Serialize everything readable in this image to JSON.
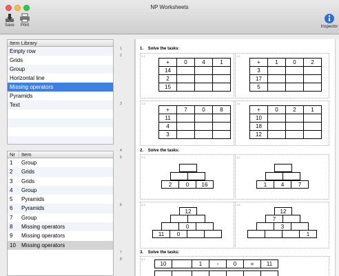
{
  "window": {
    "title": "NP Worksheets"
  },
  "toolbar": {
    "save_label": "Save",
    "print_label": "Print",
    "inspector_label": "Inspector"
  },
  "library": {
    "header": "Item Library",
    "items": [
      "Empty  row",
      "Grids",
      "Group",
      "Horizontal line",
      "Missing operators",
      "Pyramids",
      "Text"
    ],
    "selected_index": 4
  },
  "items_list": {
    "col_nr": "Nr",
    "col_item": "Item",
    "rows": [
      {
        "nr": "1",
        "item": "Group"
      },
      {
        "nr": "2",
        "item": "Grids"
      },
      {
        "nr": "3",
        "item": "Grids"
      },
      {
        "nr": "4",
        "item": "Group"
      },
      {
        "nr": "5",
        "item": "Pyramids"
      },
      {
        "nr": "6",
        "item": "Pyramids"
      },
      {
        "nr": "7",
        "item": "Group"
      },
      {
        "nr": "8",
        "item": "Missing operators"
      },
      {
        "nr": "9",
        "item": "Missing operators"
      },
      {
        "nr": "10",
        "item": "Missing operators"
      }
    ],
    "selected_index": 9
  },
  "ruler": {
    "labels": [
      "1",
      "2",
      "3",
      "4",
      "5",
      "6",
      "7",
      "8"
    ]
  },
  "worksheet": {
    "sections": [
      {
        "num": "1.",
        "title": "Solve the tasks:"
      },
      {
        "num": "2.",
        "title": "Solve the tasks:"
      },
      {
        "num": "3.",
        "title": "Solve the tasks:"
      }
    ],
    "sublabels": [
      "1.1",
      "1.2",
      "1.3",
      "1.4",
      "2.1",
      "2.2",
      "2.3",
      "2.4",
      "3.1"
    ],
    "grids": [
      {
        "header": [
          "+",
          "0",
          "4",
          "1"
        ],
        "rows": [
          "14",
          "2",
          "15"
        ]
      },
      {
        "header": [
          "+",
          "1",
          "0",
          "2"
        ],
        "rows": [
          "3",
          "17",
          "5"
        ]
      },
      {
        "header": [
          "+",
          "7",
          "0",
          "8"
        ],
        "rows": [
          "11",
          "4",
          "3"
        ]
      },
      {
        "header": [
          "+",
          "0",
          "2",
          "1"
        ],
        "rows": [
          "10",
          "18",
          "12"
        ]
      }
    ],
    "pyramids": [
      {
        "bottom": [
          "2",
          "0",
          "16"
        ]
      },
      {
        "bottom": [
          "1",
          "4",
          "7"
        ]
      },
      {
        "top": "12",
        "mid": "0",
        "bottom": [
          "11",
          "0",
          "",
          ""
        ]
      },
      {
        "top": "12",
        "row2": "7",
        "mid": "3",
        "bottom": [
          "",
          "",
          "",
          "1"
        ]
      }
    ],
    "operators": [
      {
        "cells": [
          "10",
          "",
          "1",
          "-",
          "0",
          "=",
          "11"
        ]
      }
    ]
  }
}
